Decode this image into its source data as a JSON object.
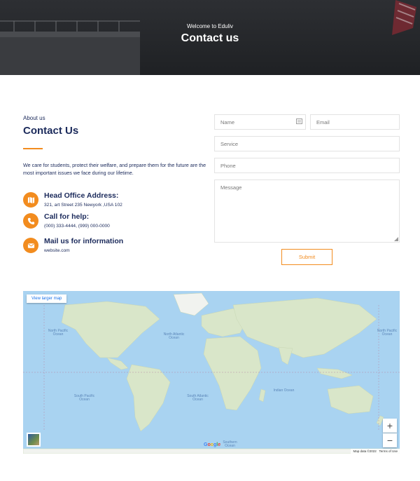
{
  "hero": {
    "subtitle": "Welcome to Eduliv",
    "title": "Contact us"
  },
  "about": {
    "label": "About us",
    "title": "Contact Us",
    "description": "We care for students, protect their welfare, and prepare them for the future are the most important issues we face during our lifetime."
  },
  "contacts": [
    {
      "title": "Head Office Address:",
      "detail": "321, art Street 235 Newyork ,USA 102",
      "icon": "map-icon"
    },
    {
      "title": "Call for help:",
      "detail": "(000) 333-4444, (999) 000-0000",
      "icon": "phone-icon"
    },
    {
      "title": "Mail us for information",
      "detail": "website.com",
      "icon": "mail-icon"
    }
  ],
  "form": {
    "name_placeholder": "Name",
    "email_placeholder": "Email",
    "service_placeholder": "Service",
    "phone_placeholder": "Phone",
    "message_placeholder": "Message",
    "submit_label": "Submit"
  },
  "map": {
    "view_larger": "View larger map",
    "zoom_in": "+",
    "zoom_out": "−",
    "attribution": "Map data ©2022",
    "terms": "Terms of Use",
    "google": "Google",
    "oceans": {
      "north_pacific_left": "North Pacific Ocean",
      "north_pacific_right": "North Pacific Ocean",
      "north_atlantic": "North Atlantic Ocean",
      "south_pacific": "South Pacific Ocean",
      "south_atlantic": "South Atlantic Ocean",
      "indian": "Indian Ocean",
      "southern": "Southern Ocean"
    }
  },
  "colors": {
    "accent": "#f28c1f",
    "navy": "#1b2a5b"
  }
}
